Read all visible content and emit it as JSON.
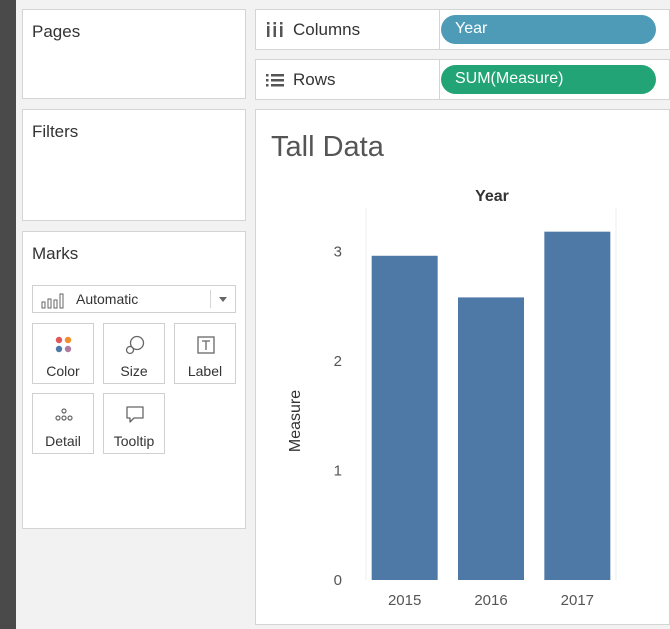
{
  "pages_card": {
    "title": "Pages"
  },
  "filters_card": {
    "title": "Filters"
  },
  "marks_card": {
    "title": "Marks",
    "mark_type": "Automatic",
    "buttons": [
      {
        "label": "Color",
        "icon": "color-icon"
      },
      {
        "label": "Size",
        "icon": "size-icon"
      },
      {
        "label": "Label",
        "icon": "label-icon"
      },
      {
        "label": "Detail",
        "icon": "detail-icon"
      },
      {
        "label": "Tooltip",
        "icon": "tooltip-icon"
      }
    ]
  },
  "shelves": {
    "columns": {
      "label": "Columns",
      "pill": "Year"
    },
    "rows": {
      "label": "Rows",
      "pill": "SUM(Measure)"
    }
  },
  "colors": {
    "columns_pill": "#4e9bb8",
    "rows_pill": "#23a476",
    "bar": "#4e79a7"
  },
  "view": {
    "title": "Tall Data"
  },
  "chart_data": {
    "type": "bar",
    "title": "",
    "xlabel": "Year",
    "ylabel": "Measure",
    "categories": [
      "2015",
      "2016",
      "2017"
    ],
    "values": [
      2.96,
      2.58,
      3.18
    ],
    "ylim": [
      0,
      3.25
    ],
    "yticks": [
      "0",
      "1",
      "2",
      "3"
    ],
    "grid": false,
    "legend": "none"
  }
}
